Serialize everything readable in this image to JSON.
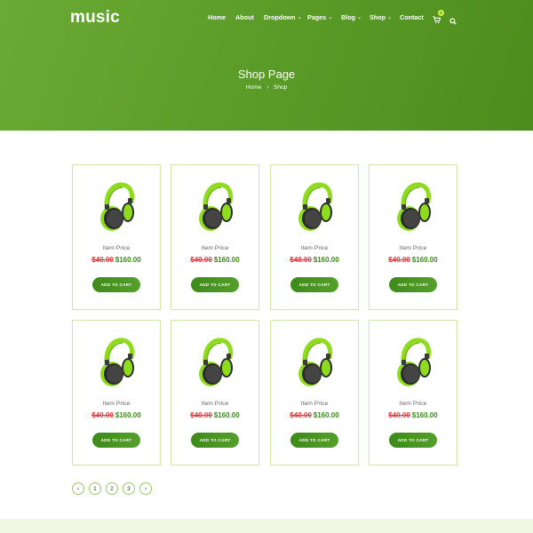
{
  "brand": {
    "logo": "music"
  },
  "nav": {
    "items": [
      {
        "label": "Home",
        "caret": false
      },
      {
        "label": "About",
        "caret": false
      },
      {
        "label": "Dropdown",
        "caret": true
      },
      {
        "label": "Pages",
        "caret": true
      },
      {
        "label": "Blog",
        "caret": true
      },
      {
        "label": "Shop",
        "caret": true
      },
      {
        "label": "Contact",
        "caret": false
      }
    ],
    "cart_icon": "cart-icon",
    "cart_count": "0",
    "search_icon": "search-icon"
  },
  "hero": {
    "title": "Shop Page",
    "breadcrumb": [
      "Home",
      "Shop"
    ],
    "breadcrumb_separator": "›"
  },
  "products": [
    {
      "name": "Item Price",
      "old_price": "$40.00",
      "new_price": "$160.00",
      "button": "ADD TO CART"
    },
    {
      "name": "Item Price",
      "old_price": "$40.00",
      "new_price": "$160.00",
      "button": "ADD TO CART"
    },
    {
      "name": "Item Price",
      "old_price": "$40.00",
      "new_price": "$160.00",
      "button": "ADD TO CART"
    },
    {
      "name": "Item Price",
      "old_price": "$40.00",
      "new_price": "$160.00",
      "button": "ADD TO CART"
    },
    {
      "name": "Item Price",
      "old_price": "$40.00",
      "new_price": "$160.00",
      "button": "ADD TO CART"
    },
    {
      "name": "Item Price",
      "old_price": "$40.00",
      "new_price": "$160.00",
      "button": "ADD TO CART"
    },
    {
      "name": "Item Price",
      "old_price": "$40.00",
      "new_price": "$160.00",
      "button": "ADD TO CART"
    },
    {
      "name": "Item Price",
      "old_price": "$40.00",
      "new_price": "$160.00",
      "button": "ADD TO CART"
    }
  ],
  "pagination": {
    "prev": "‹",
    "pages": [
      "1",
      "2",
      "3"
    ],
    "next": "›"
  },
  "colors": {
    "brand_green": "#4d8c1c",
    "accent_lime": "#8fdc1e",
    "sale_red": "#e8373f",
    "price_green": "#3c8a19"
  }
}
